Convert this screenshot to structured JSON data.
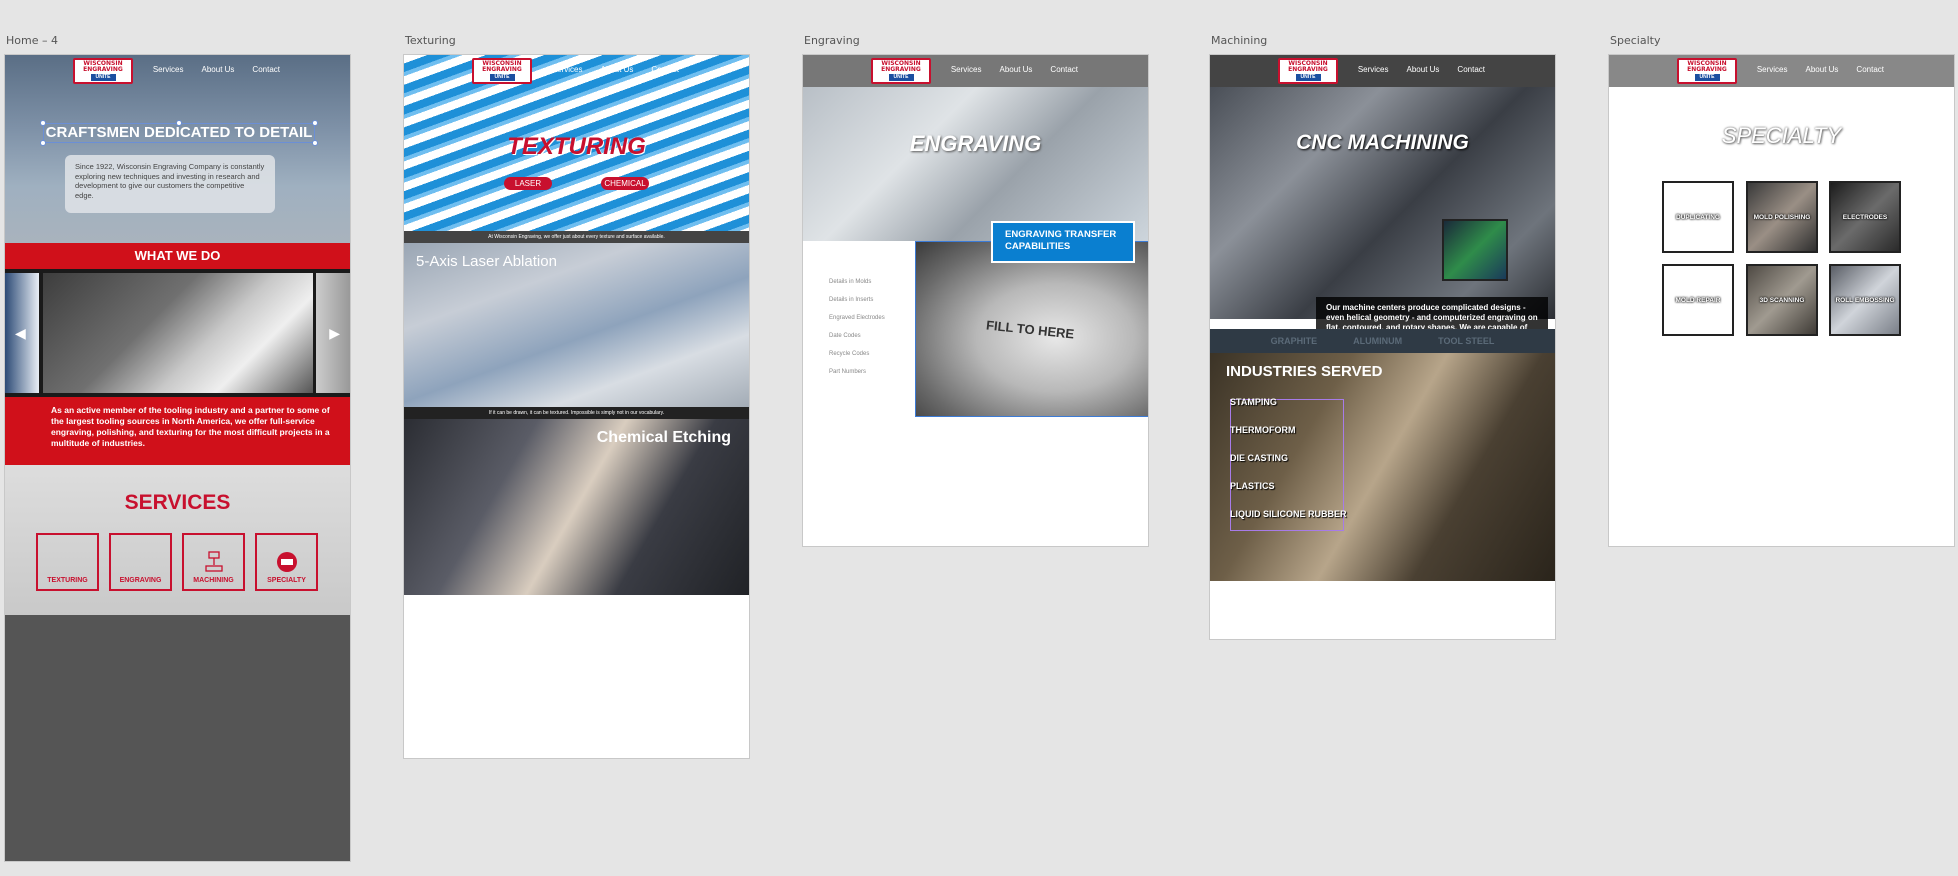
{
  "artboards": {
    "home_label": "Home – 4",
    "texturing_label": "Texturing",
    "engraving_label": "Engraving",
    "machining_label": "Machining",
    "specialty_label": "Specialty"
  },
  "logo": {
    "line1": "WISCONSIN",
    "line2": "ENGRAVING",
    "line3": "UNITE"
  },
  "nav": {
    "services": "Services",
    "about": "About Us",
    "contact": "Contact"
  },
  "home": {
    "hero_title": "CRAFTSMEN DEDICATED TO DETAIL",
    "hero_text": "Since 1922, Wisconsin Engraving Company is constantly exploring new techniques and investing in research and development to give our customers the competitive edge.",
    "what_we_do": "WHAT WE DO",
    "prev_arrow": "◀",
    "next_arrow": "▶",
    "about_text": "As an active member of the tooling industry and a partner to some of the largest tooling sources in North America, we offer full-service engraving, polishing, and texturing for the most difficult projects in a multitude of industries.",
    "services_title": "SERVICES",
    "services": [
      "TEXTURING",
      "ENGRAVING",
      "MACHINING",
      "SPECIALTY"
    ]
  },
  "texturing": {
    "title": "TEXTURING",
    "pill_laser": "LASER",
    "pill_chemical": "CHEMICAL",
    "strip1": "At Wisconsin Engraving, we offer just about every texture and surface available.",
    "laser_title": "5-Axis Laser Ablation",
    "strip2": "If it can be drawn, it can be textured. Impossible is simply not in our vocabulary.",
    "chem_title": "Chemical Etching"
  },
  "engraving": {
    "title": "ENGRAVING",
    "box_text": "ENGRAVING TRANSFER CAPABILITIES",
    "photo_text": "FILL TO HERE",
    "list": [
      "Details in Molds",
      "Details in Inserts",
      "Engraved Electrodes",
      "Date Codes",
      "Recycle Codes",
      "Part Numbers"
    ]
  },
  "machining": {
    "title": "CNC MACHINING",
    "card_text": "Our machine centers produce complicated designs - even helical geometry - and computerized engraving on flat, contoured, and rotary shapes. We are capable of producing intricate prototypes and accurate repeatability of electrodes.",
    "tabs": [
      "GRAPHITE",
      "ALUMINUM",
      "TOOL STEEL"
    ],
    "industries_title": "INDUSTRIES SERVED",
    "industries": [
      "STAMPING",
      "THERMOFORM",
      "DIE CASTING",
      "PLASTICS",
      "LIQUID SILICONE RUBBER"
    ]
  },
  "specialty": {
    "title": "SPECIALTY",
    "tiles": [
      "DUPLICATING",
      "MOLD POLISHING",
      "ELECTRODES",
      "MOLD REPAIR",
      "3D SCANNING",
      "ROLL EMBOSSING"
    ]
  }
}
